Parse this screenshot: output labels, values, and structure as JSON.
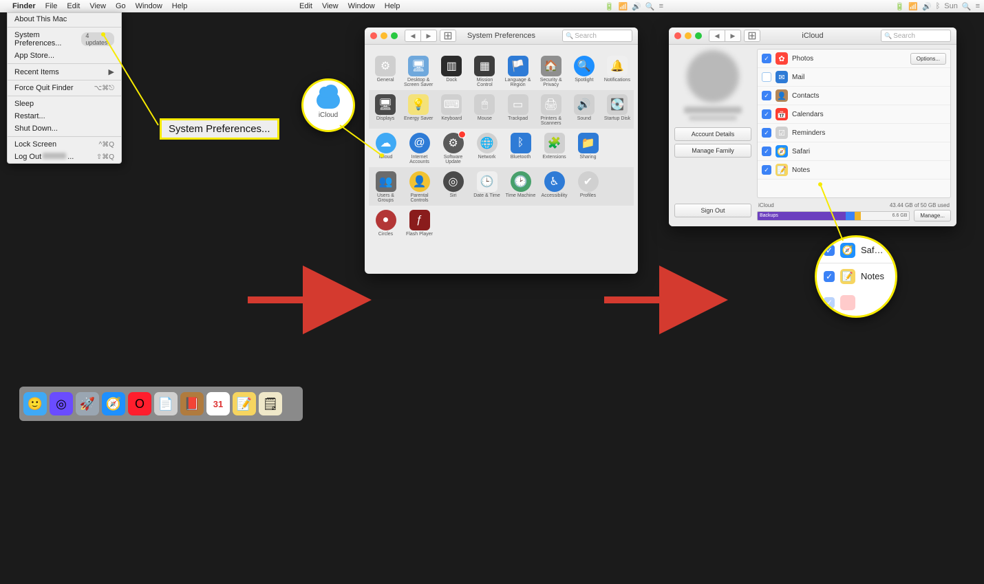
{
  "panel1": {
    "menubar": {
      "app": "Finder",
      "items": [
        "File",
        "Edit",
        "View",
        "Go",
        "Window",
        "Help"
      ]
    },
    "dropdown": {
      "about": "About This Mac",
      "sysprefs": "System Preferences...",
      "updates_pill": "4 updates",
      "appstore": "App Store...",
      "recent": "Recent Items",
      "forcequit": "Force Quit Finder",
      "forcequit_sc": "⌥⌘⎋",
      "sleep": "Sleep",
      "restart": "Restart...",
      "shutdown": "Shut Down...",
      "lock": "Lock Screen",
      "lock_sc": "^⌘Q",
      "logout": "Log Out",
      "logout_sc": "⇧⌘Q"
    },
    "callout": "System Preferences..."
  },
  "panel2": {
    "menubar": {
      "items": [
        "Edit",
        "View",
        "Window",
        "Help"
      ]
    },
    "window_title": "System Preferences",
    "search_ph": "Search",
    "callout_caption": "iCloud",
    "items": [
      [
        {
          "n": "General",
          "c": "#cfcfcf",
          "e": "⚙︎"
        },
        {
          "n": "Desktop & Screen Saver",
          "c": "#6fa8dc",
          "e": "🖥"
        },
        {
          "n": "Dock",
          "c": "#2b2b2b",
          "e": "▥"
        },
        {
          "n": "Mission Control",
          "c": "#3d3d3d",
          "e": "▦"
        },
        {
          "n": "Language & Region",
          "c": "#2e7bd6",
          "e": "🏳️"
        },
        {
          "n": "Security & Privacy",
          "c": "#8f8f8f",
          "e": "🏠"
        },
        {
          "n": "Spotlight",
          "c": "#1e90ff",
          "e": "🔍",
          "circ": true
        },
        {
          "n": "Notifications",
          "c": "#efefef",
          "e": "🔔"
        }
      ],
      [
        {
          "n": "Displays",
          "c": "#4a4a4a",
          "e": "🖥"
        },
        {
          "n": "Energy Saver",
          "c": "#f4e27a",
          "e": "💡"
        },
        {
          "n": "Keyboard",
          "c": "#d0d0d0",
          "e": "⌨︎"
        },
        {
          "n": "Mouse",
          "c": "#d0d0d0",
          "e": "🖱"
        },
        {
          "n": "Trackpad",
          "c": "#d0d0d0",
          "e": "▭"
        },
        {
          "n": "Printers & Scanners",
          "c": "#d0d0d0",
          "e": "🖨"
        },
        {
          "n": "Sound",
          "c": "#d0d0d0",
          "e": "🔊"
        },
        {
          "n": "Startup Disk",
          "c": "#d0d0d0",
          "e": "💽"
        }
      ],
      [
        {
          "n": "iCloud",
          "c": "#3fa9f5",
          "e": "☁︎",
          "circ": true
        },
        {
          "n": "Internet Accounts",
          "c": "#2e7bd6",
          "e": "@",
          "circ": true
        },
        {
          "n": "Software Update",
          "c": "#5a5a5a",
          "e": "⚙︎",
          "circ": true,
          "badge": true
        },
        {
          "n": "Network",
          "c": "#d0d0d0",
          "e": "🌐",
          "circ": true
        },
        {
          "n": "Bluetooth",
          "c": "#2e7bd6",
          "e": "ᛒ"
        },
        {
          "n": "Extensions",
          "c": "#d0d0d0",
          "e": "🧩"
        },
        {
          "n": "Sharing",
          "c": "#2e7bd6",
          "e": "📁"
        }
      ],
      [
        {
          "n": "Users & Groups",
          "c": "#6b6b6b",
          "e": "👥"
        },
        {
          "n": "Parental Controls",
          "c": "#f1c232",
          "e": "👤",
          "circ": true
        },
        {
          "n": "Siri",
          "c": "#4a4a4a",
          "e": "◎",
          "circ": true
        },
        {
          "n": "Date & Time",
          "c": "#efefef",
          "e": "🕒"
        },
        {
          "n": "Time Machine",
          "c": "#47a06b",
          "e": "🕑",
          "circ": true
        },
        {
          "n": "Accessibility",
          "c": "#2e7bd6",
          "e": "♿︎",
          "circ": true
        },
        {
          "n": "Profiles",
          "c": "#d0d0d0",
          "e": "✔︎",
          "circ": true
        }
      ],
      [
        {
          "n": "Circles",
          "c": "#b33636",
          "e": "●",
          "circ": true
        },
        {
          "n": "Flash Player",
          "c": "#8a1c1c",
          "e": "ƒ"
        }
      ]
    ]
  },
  "panel3": {
    "menubar_right": "Sun",
    "window_title": "iCloud",
    "search_ph": "Search",
    "account_details": "Account Details",
    "manage_family": "Manage Family",
    "sign_out": "Sign Out",
    "options": "Options...",
    "storage_label": "iCloud",
    "storage_text": "43.44 GB of 50 GB used",
    "storage_segments": [
      {
        "label": "Backups",
        "w": 58,
        "c": "#6b3fbf"
      },
      {
        "label": "",
        "w": 6,
        "c": "#3b82f6"
      },
      {
        "label": "",
        "w": 4,
        "c": "#f0b429"
      }
    ],
    "storage_free_label": "6.6 GB",
    "manage": "Manage...",
    "list": [
      {
        "name": "Photos",
        "checked": true,
        "c": "#ff453a",
        "e": "✿",
        "opt": true
      },
      {
        "name": "Mail",
        "checked": false,
        "c": "#2e7bd6",
        "e": "✉︎"
      },
      {
        "name": "Contacts",
        "checked": true,
        "c": "#b38556",
        "e": "👤"
      },
      {
        "name": "Calendars",
        "checked": true,
        "c": "#ff3b30",
        "e": "📅"
      },
      {
        "name": "Reminders",
        "checked": true,
        "c": "#d0d0d0",
        "e": "☑︎"
      },
      {
        "name": "Safari",
        "checked": true,
        "c": "#1e90ff",
        "e": "🧭"
      },
      {
        "name": "Notes",
        "checked": true,
        "c": "#f6d560",
        "e": "📝"
      }
    ],
    "mag_rows": [
      {
        "name": "Safari",
        "short": "Saf…",
        "c": "#1e90ff",
        "e": "🧭"
      },
      {
        "name": "Notes",
        "c": "#f6d560",
        "e": "📝"
      }
    ]
  },
  "dock_apps": [
    {
      "n": "Finder",
      "c": "#3fa9f5",
      "e": "🙂"
    },
    {
      "n": "Siri",
      "c": "#6a4cff",
      "e": "◎"
    },
    {
      "n": "Launchpad",
      "c": "#9aa6b2",
      "e": "🚀"
    },
    {
      "n": "Safari",
      "c": "#1e90ff",
      "e": "🧭"
    },
    {
      "n": "Opera",
      "c": "#ff1e2d",
      "e": "O"
    },
    {
      "n": "TextEdit",
      "c": "#d0d0d0",
      "e": "📄"
    },
    {
      "n": "Books",
      "c": "#b07b3e",
      "e": "📕"
    },
    {
      "n": "Calendar",
      "c": "#ffffff",
      "e": "31"
    },
    {
      "n": "Notes",
      "c": "#f6d560",
      "e": "📝"
    },
    {
      "n": "Stickies",
      "c": "#efe8c9",
      "e": "🗒"
    }
  ]
}
